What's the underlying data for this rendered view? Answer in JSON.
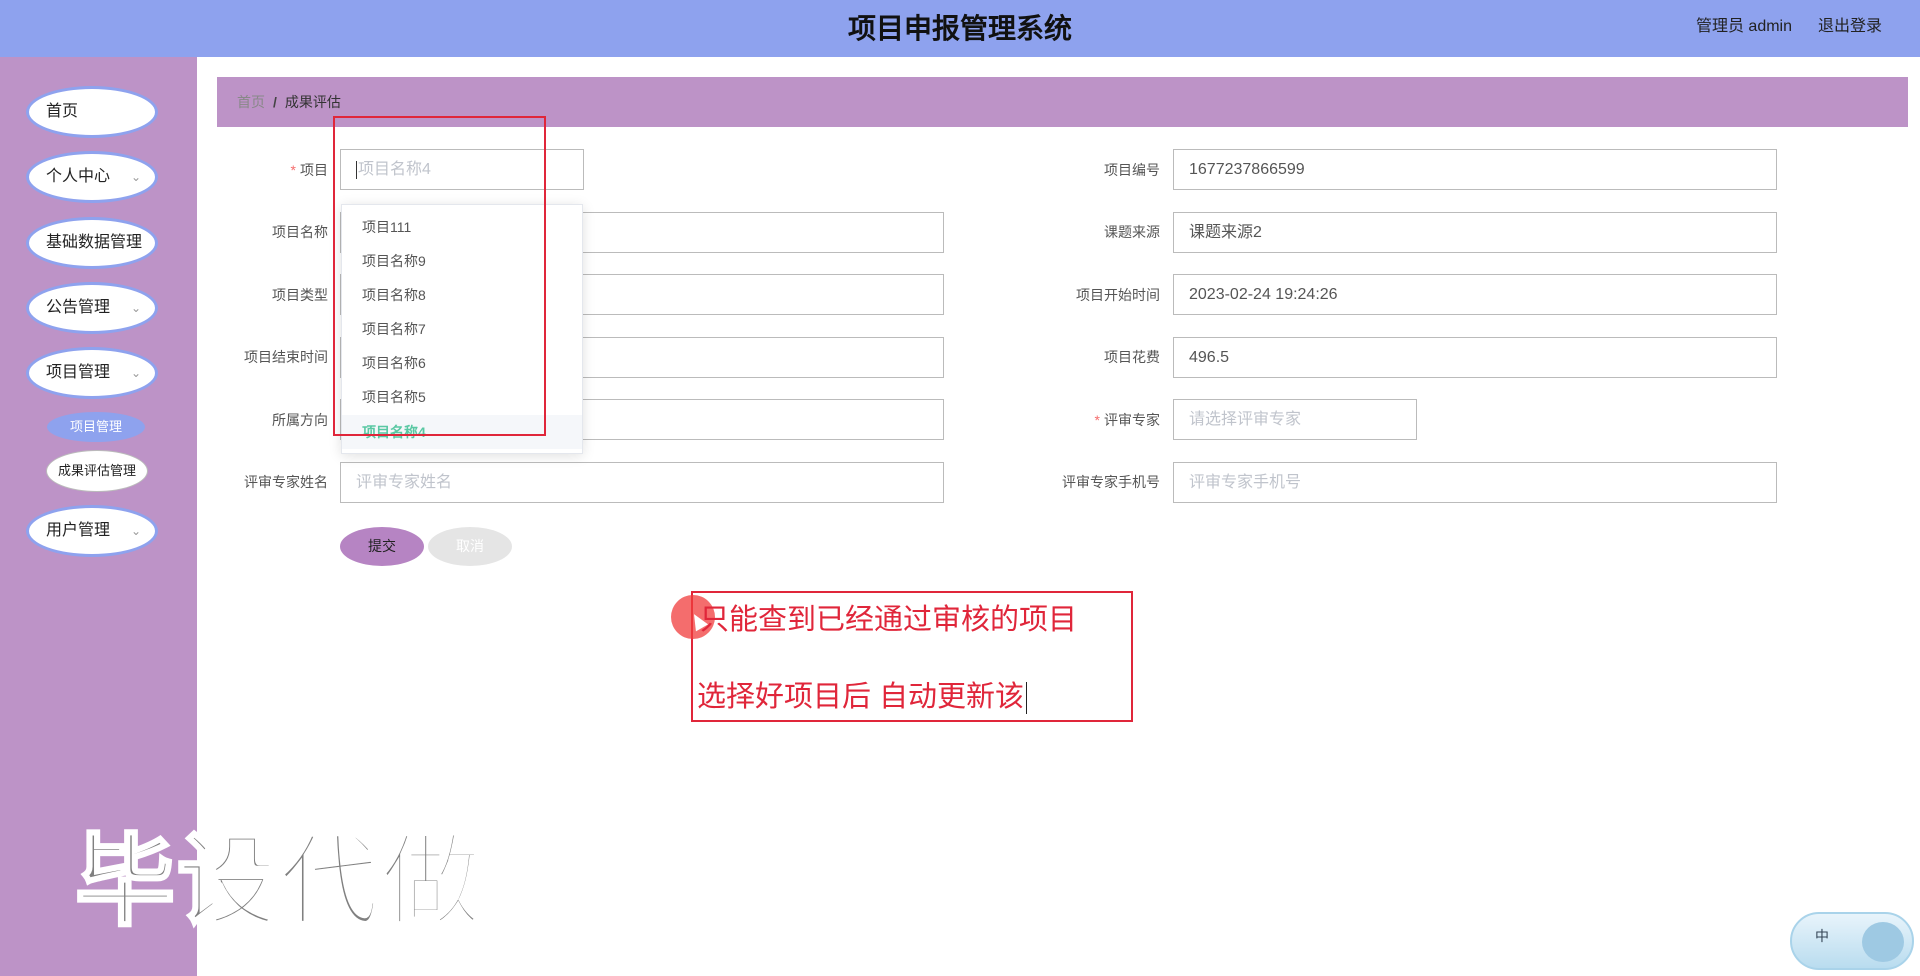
{
  "header": {
    "title": "项目申报管理系统",
    "admin": "管理员 admin",
    "logout": "退出登录",
    "color": "#8ea2ee"
  },
  "sidebar": {
    "items": [
      {
        "label": "首页",
        "has_arrow": false
      },
      {
        "label": "个人中心",
        "has_arrow": true
      },
      {
        "label": "基础数据管理",
        "has_arrow": true
      },
      {
        "label": "公告管理",
        "has_arrow": true
      },
      {
        "label": "项目管理",
        "has_arrow": true
      },
      {
        "label": "用户管理",
        "has_arrow": true
      }
    ],
    "sub_items": [
      {
        "label": "项目管理",
        "active": true
      },
      {
        "label": "成果评估管理",
        "active": false
      }
    ],
    "color": "#bd93c7"
  },
  "watermark": "毕设代做",
  "breadcrumb": {
    "home": "首页",
    "sep": "/",
    "current": "成果评估"
  },
  "form": {
    "left": [
      {
        "label": "项目",
        "required": true,
        "value": "",
        "placeholder": "项目名称4"
      },
      {
        "label": "项目名称",
        "value": ""
      },
      {
        "label": "项目类型",
        "value": ""
      },
      {
        "label": "项目结束时间",
        "value": ""
      },
      {
        "label": "所属方向",
        "value": ""
      },
      {
        "label": "评审专家姓名",
        "value": "",
        "placeholder": "评审专家姓名"
      }
    ],
    "right": [
      {
        "label": "项目编号",
        "value": "1677237866599"
      },
      {
        "label": "课题来源",
        "value": "课题来源2"
      },
      {
        "label": "项目开始时间",
        "value": "2023-02-24 19:24:26"
      },
      {
        "label": "项目花费",
        "value": "496.5"
      },
      {
        "label": "评审专家",
        "required": true,
        "value": "",
        "placeholder": "请选择评审专家"
      },
      {
        "label": "评审专家手机号",
        "value": "",
        "placeholder": "评审专家手机号"
      }
    ],
    "submit": "提交",
    "cancel": "取消"
  },
  "dropdown": {
    "options": [
      "项目111",
      "项目名称9",
      "项目名称8",
      "项目名称7",
      "项目名称6",
      "项目名称5",
      "项目名称4"
    ],
    "selected_index": 6
  },
  "annotation": {
    "line1": "只能查到已经通过审核的项目",
    "line2": "选择好项目后 自动更新该"
  },
  "ime": {
    "label": "中"
  }
}
